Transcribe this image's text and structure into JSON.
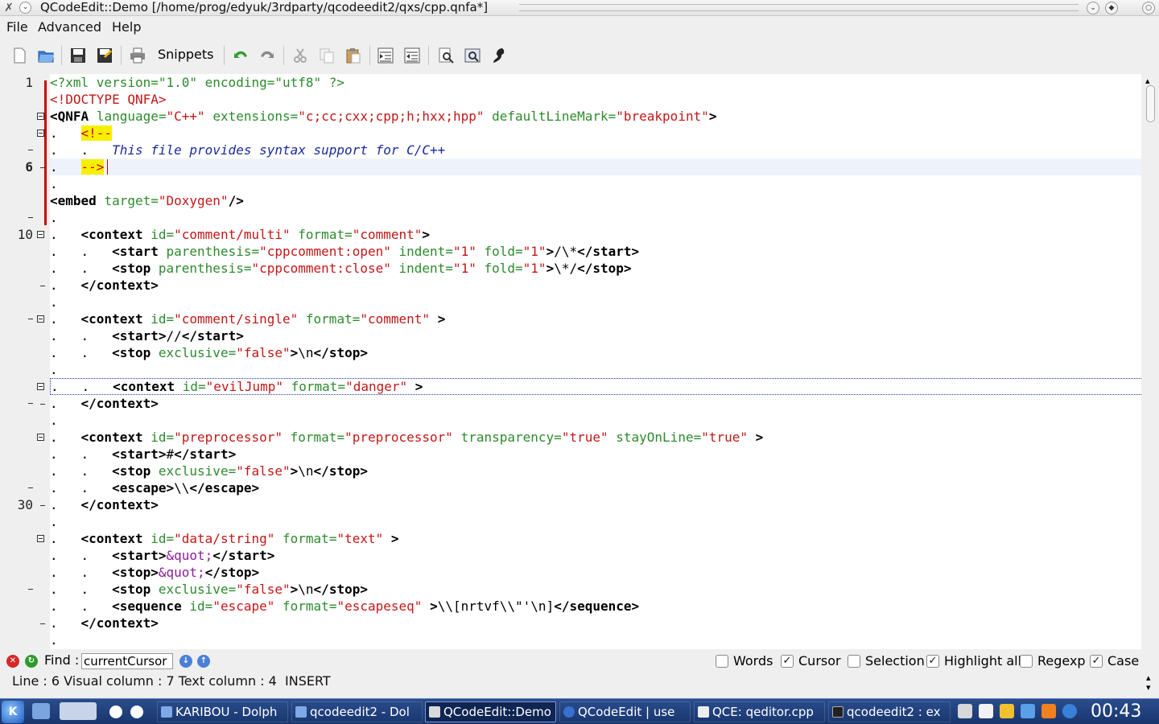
{
  "window": {
    "title": "QCodeEdit::Demo [/home/prog/edyuk/3rdparty/qcodeedit2/qxs/cpp.qnfa*]"
  },
  "menu": [
    "File",
    "Advanced",
    "Help"
  ],
  "toolbar": {
    "snippets_label": "Snippets",
    "icons": [
      "new-file-icon",
      "open-file-icon",
      "save-icon",
      "save-all-icon",
      "print-icon",
      "undo-icon",
      "redo-icon",
      "cut-icon",
      "copy-icon",
      "paste-icon",
      "indent-icon",
      "unindent-icon",
      "find-icon",
      "replace-icon",
      "goto-line-icon"
    ]
  },
  "gutter": {
    "line_numbers": [
      {
        "n": "1",
        "bold": false
      },
      {
        "n": "6",
        "bold": true
      },
      {
        "n": "10",
        "bold": false
      },
      {
        "n": "30",
        "bold": false
      }
    ]
  },
  "code_lines": [
    "<?xml version=\"1.0\" encoding=\"utf8\" ?>",
    "<!DOCTYPE QNFA>",
    "<QNFA language=\"C++\" extensions=\"c;cc;cxx;cpp;h;hxx;hpp\" defaultLineMark=\"breakpoint\">",
    "<!--",
    "This file provides syntax support for C/C++",
    "-->",
    "",
    "<embed target=\"Doxygen\"/>",
    "",
    "<context id=\"comment/multi\" format=\"comment\">",
    "<start parenthesis=\"cppcomment:open\" indent=\"1\" fold=\"1\">/\\*</start>",
    "<stop parenthesis=\"cppcomment:close\" indent=\"1\" fold=\"1\">\\*/</stop>",
    "</context>",
    "",
    "<context id=\"comment/single\" format=\"comment\" >",
    "<start>//</start>",
    "<stop exclusive=\"false\">\\n</stop>",
    "",
    "<context id=\"evilJump\" format=\"danger\" >",
    "</context>",
    "",
    "<context id=\"preprocessor\" format=\"preprocessor\" transparency=\"true\" stayOnLine=\"true\" >",
    "<start>#</start>",
    "<stop exclusive=\"false\">\\n</stop>",
    "<escape>\\\\</escape>",
    "</context>",
    "",
    "<context id=\"data/string\" format=\"text\" >",
    "<start>&quot;</start>",
    "<stop>&quot;</stop>",
    "<stop exclusive=\"false\">\\n</stop>",
    "<sequence id=\"escape\" format=\"escapeseq\" >\\\\[nrtvf\\\\\"'\\n]</sequence>",
    "</context>",
    ""
  ],
  "findbar": {
    "label": "Find :",
    "value": "currentCursor",
    "options": [
      {
        "label": "Words",
        "checked": false
      },
      {
        "label": "Cursor",
        "checked": true
      },
      {
        "label": "Selection",
        "checked": false
      },
      {
        "label": "Highlight all",
        "checked": true
      },
      {
        "label": "Regexp",
        "checked": false
      },
      {
        "label": "Case",
        "checked": true
      }
    ]
  },
  "status": {
    "text": "Line : 6 Visual column : 7 Text column : 4  INSERT"
  },
  "taskbar": {
    "tasks": [
      {
        "label": "KARIBOU - Dolph",
        "active": false
      },
      {
        "label": "qcodeedit2 - Dol",
        "active": false
      },
      {
        "label": "QCodeEdit::Demo",
        "active": true
      },
      {
        "label": "QCodeEdit | use",
        "active": false
      },
      {
        "label": "QCE: qeditor.cpp",
        "active": false
      },
      {
        "label": "qcodeedit2 : ex",
        "active": false
      }
    ],
    "clock": "00:43"
  }
}
